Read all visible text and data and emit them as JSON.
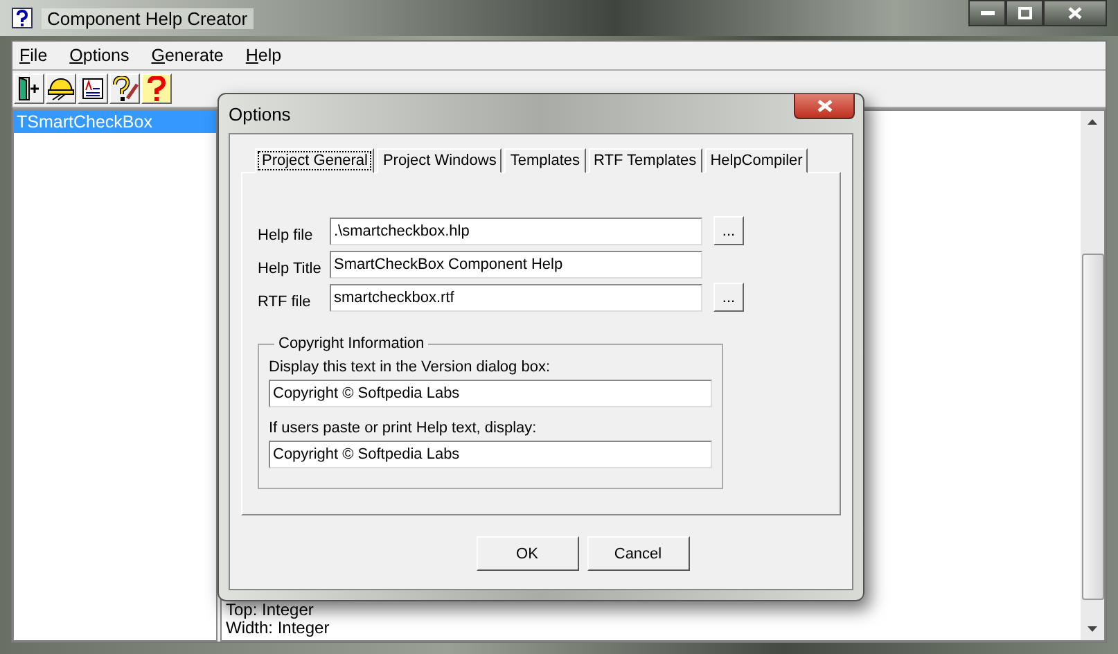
{
  "window": {
    "title": "Component Help Creator"
  },
  "menu": [
    "File",
    "Options",
    "Generate",
    "Help"
  ],
  "component_list": [
    {
      "label": "TSmartCheckBox",
      "selected": true
    }
  ],
  "details": [
    "Top: Integer",
    "Width: Integer"
  ],
  "dialog": {
    "title": "Options",
    "tabs": [
      {
        "label": "Project General",
        "selected": true
      },
      {
        "label": "Project Windows",
        "selected": false
      },
      {
        "label": "Templates",
        "selected": false
      },
      {
        "label": "RTF Templates",
        "selected": false
      },
      {
        "label": "HelpCompiler",
        "selected": false
      }
    ],
    "fields": [
      {
        "label": "Help file",
        "value": ".\\smartcheckbox.hlp",
        "browse": "..."
      },
      {
        "label": "Help Title",
        "value": "SmartCheckBox Component Help"
      },
      {
        "label": "RTF file",
        "value": "smartcheckbox.rtf",
        "browse": "..."
      }
    ],
    "group": {
      "title": "Copyright Information",
      "fields": [
        {
          "label": "Display this text in the Version dialog box:",
          "value": "Copyright © Softpedia Labs"
        },
        {
          "label": "If users paste or print Help text, display:",
          "value": "Copyright © Softpedia Labs"
        }
      ]
    },
    "buttons": [
      "OK",
      "Cancel"
    ]
  }
}
